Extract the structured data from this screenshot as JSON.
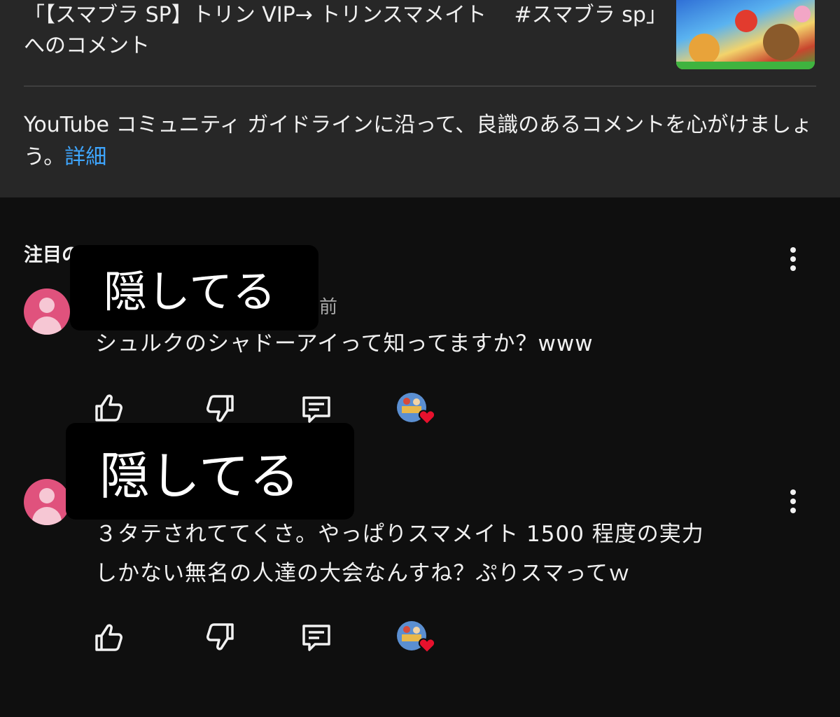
{
  "video": {
    "title": "「【スマブラ SP】トリン VIP→ トリンスマメイト　 #スマブラ sp」\nへのコメント"
  },
  "guideline": {
    "text": "YouTube コミュニティ ガイドラインに沿って、良識のあるコメントを心がけましょう。",
    "link": "詳細"
  },
  "comments_section": {
    "label": "注目のコメント",
    "redaction_label": "隠してる"
  },
  "comments": [
    {
      "time_suffix": "間前",
      "text": "シュルクのシャドーアイって知ってますか？www"
    },
    {
      "text_line1": "３タテされててくさ。やっぱりスマメイト 1500 程度の実力",
      "text_line2": "しかない無名の人達の大会なんすね？ぷりスマってｗ"
    }
  ],
  "icons": {
    "like": "thumbs-up-icon",
    "dislike": "thumbs-down-icon",
    "reply": "reply-comment-icon",
    "creator_heart": "creator-heart-avatar",
    "more": "more-vertical-icon"
  },
  "colors": {
    "panel": "#272727",
    "background": "#0f0f0f",
    "link": "#3ea6ff",
    "heart": "#e8112d",
    "avatar": "#e0527d"
  }
}
